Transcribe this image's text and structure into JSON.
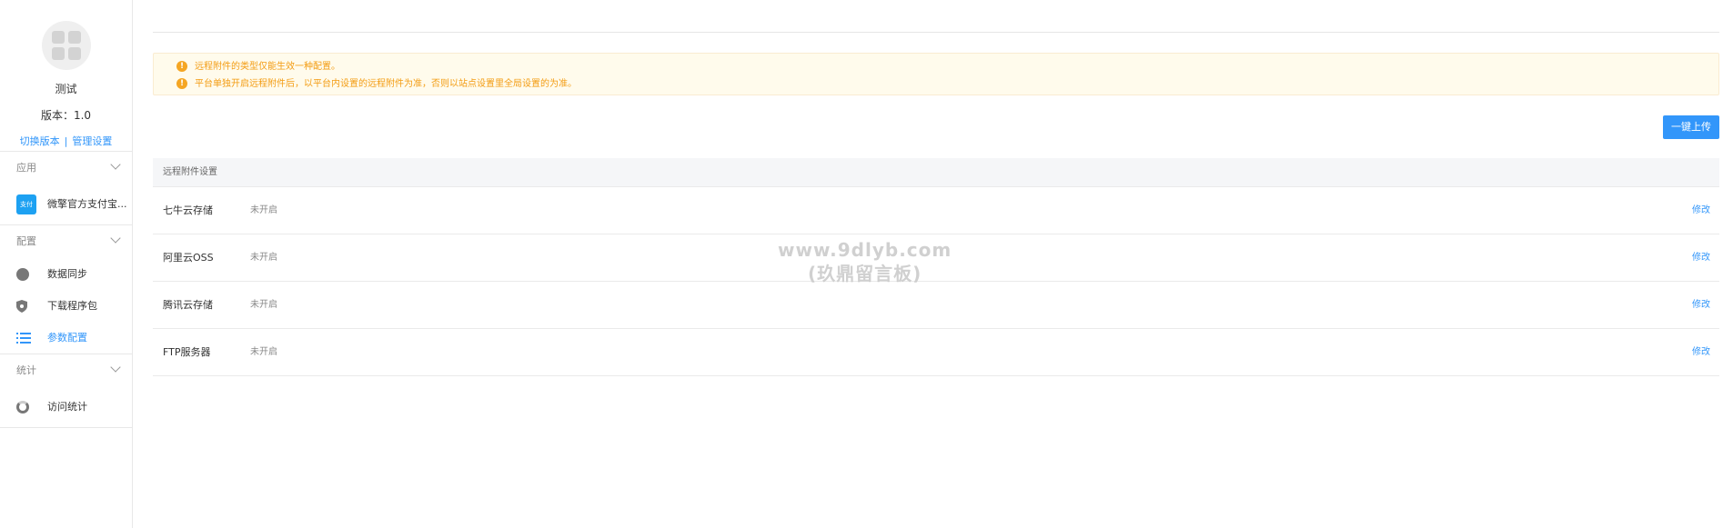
{
  "app": {
    "name": "测试",
    "version": "版本：1.0",
    "switch_version": "切换版本",
    "separator": "|",
    "manage_settings": "管理设置"
  },
  "sidebar": {
    "groups": [
      {
        "title": "应用",
        "items": [
          {
            "label": "微擎官方支付宝...",
            "icon": "brand-app-icon",
            "icon_text": "支付"
          }
        ]
      },
      {
        "title": "配置",
        "items": [
          {
            "label": "数据同步",
            "icon": "sync-icon"
          },
          {
            "label": "下载程序包",
            "icon": "shield-icon"
          },
          {
            "label": "参数配置",
            "icon": "list-icon",
            "active": true
          }
        ]
      },
      {
        "title": "统计",
        "items": [
          {
            "label": "访问统计",
            "icon": "chart-ring-icon"
          }
        ]
      }
    ]
  },
  "notice": {
    "lines": [
      "远程附件的类型仅能生效一种配置。",
      "平台单独开启远程附件后，以平台内设置的远程附件为准，否则以站点设置里全局设置的为准。"
    ],
    "icon_glyph": "!"
  },
  "toolbar": {
    "upload_label": "一键上传"
  },
  "table": {
    "header": "远程附件设置",
    "rows": [
      {
        "name": "七牛云存储",
        "status": "未开启",
        "action": "修改"
      },
      {
        "name": "阿里云OSS",
        "status": "未开启",
        "action": "修改"
      },
      {
        "name": "腾讯云存储",
        "status": "未开启",
        "action": "修改"
      },
      {
        "name": "FTP服务器",
        "status": "未开启",
        "action": "修改"
      }
    ]
  },
  "watermark": {
    "line1": "www.9dlyb.com",
    "line2": "(玖鼎留言板)"
  },
  "colors": {
    "accent": "#3296fa",
    "warning": "#f39c12",
    "notice_bg": "#fffbec"
  }
}
